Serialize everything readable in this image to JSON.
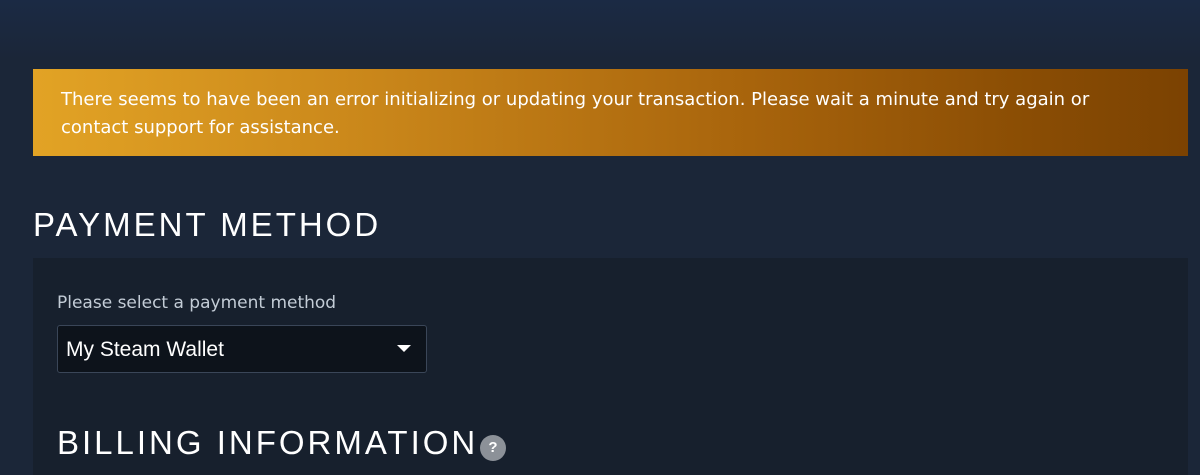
{
  "error_banner": {
    "message": "There seems to have been an error initializing or updating your transaction. Please wait a minute and try again or contact support for assistance."
  },
  "payment_method": {
    "title": "PAYMENT METHOD",
    "select_label": "Please select a payment method",
    "selected_value": "My Steam Wallet"
  },
  "billing": {
    "title": "BILLING INFORMATION",
    "help_icon": "question-mark-icon",
    "help_glyph": "?"
  },
  "colors": {
    "page_background": "#1b2638",
    "panel_background": "#17202d",
    "banner_start": "#e2a325",
    "banner_end": "#7b4202",
    "text": "#ffffff"
  }
}
